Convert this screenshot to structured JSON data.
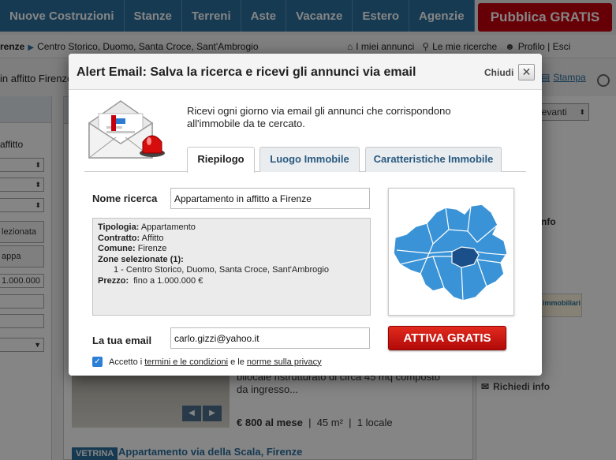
{
  "background": {
    "nav": [
      "Nuove Costruzioni",
      "Stanze",
      "Terreni",
      "Aste",
      "Vacanze",
      "Estero",
      "Agenzie"
    ],
    "publish_button": "Pubblica GRATIS",
    "breadcrumb": {
      "city": "renze",
      "zones": "Centro Storico, Duomo, Santa Croce, Sant'Ambrogio"
    },
    "user_links": {
      "ads": "I miei annunci",
      "searches": "Le mie ricerche",
      "profile": "Profilo | Esci"
    },
    "results_title": "in affitto Firenze",
    "print_label": "Stampa",
    "left_filters": {
      "affitto": "affitto",
      "zone_selected": "lezionata",
      "map": "appa",
      "price": "1.000.000"
    },
    "sort_value": "levanti",
    "info_label": "nfo",
    "agency_logo_text": "immobiliari",
    "listing": {
      "description": "bilocale ristrutturato di circa 45 mq composto da ingresso...",
      "price": "€ 800 al mese",
      "area": "45 m²",
      "rooms": "1 locale"
    },
    "request_info": "Richiedi info",
    "vetrina_badge": "VETRINA",
    "listing2_title": "Appartamento via della Scala, Firenze"
  },
  "modal": {
    "title": "Alert Email: Salva la ricerca e ricevi gli annunci via email",
    "close_label": "Chiudi",
    "close_glyph": "✕",
    "intro": "Ricevi ogni giorno via email gli annunci che corrispondono all'immobile da te cercato.",
    "tabs": [
      "Riepilogo",
      "Luogo Immobile",
      "Caratteristiche Immobile"
    ],
    "name_label": "Nome ricerca",
    "name_value": "Appartamento in affitto a Firenze",
    "summary": {
      "tipologia_label": "Tipologia:",
      "tipologia": "Appartamento",
      "contratto_label": "Contratto:",
      "contratto": "Affitto",
      "comune_label": "Comune:",
      "comune": "Firenze",
      "zone_label": "Zone selezionate (1):",
      "zone_item": "1 - Centro Storico, Duomo, Santa Croce, Sant'Ambrogio",
      "prezzo_label": "Prezzo:",
      "prezzo": "fino a 1.000.000 €"
    },
    "email_label": "La tua email",
    "email_value": "carlo.gizzi@yahoo.it",
    "activate_label": "ATTIVA GRATIS",
    "consent": {
      "prefix": "Accetto i",
      "terms": "termini e le condizioni",
      "middle": "e le",
      "privacy": "norme sulla privacy"
    }
  },
  "colors": {
    "nav_blue": "#2b6f9d",
    "publish_red": "#c5000c",
    "map_blue": "#3a93d6",
    "map_selected": "#1b4f8a",
    "activate_red": "#cf1a14"
  }
}
